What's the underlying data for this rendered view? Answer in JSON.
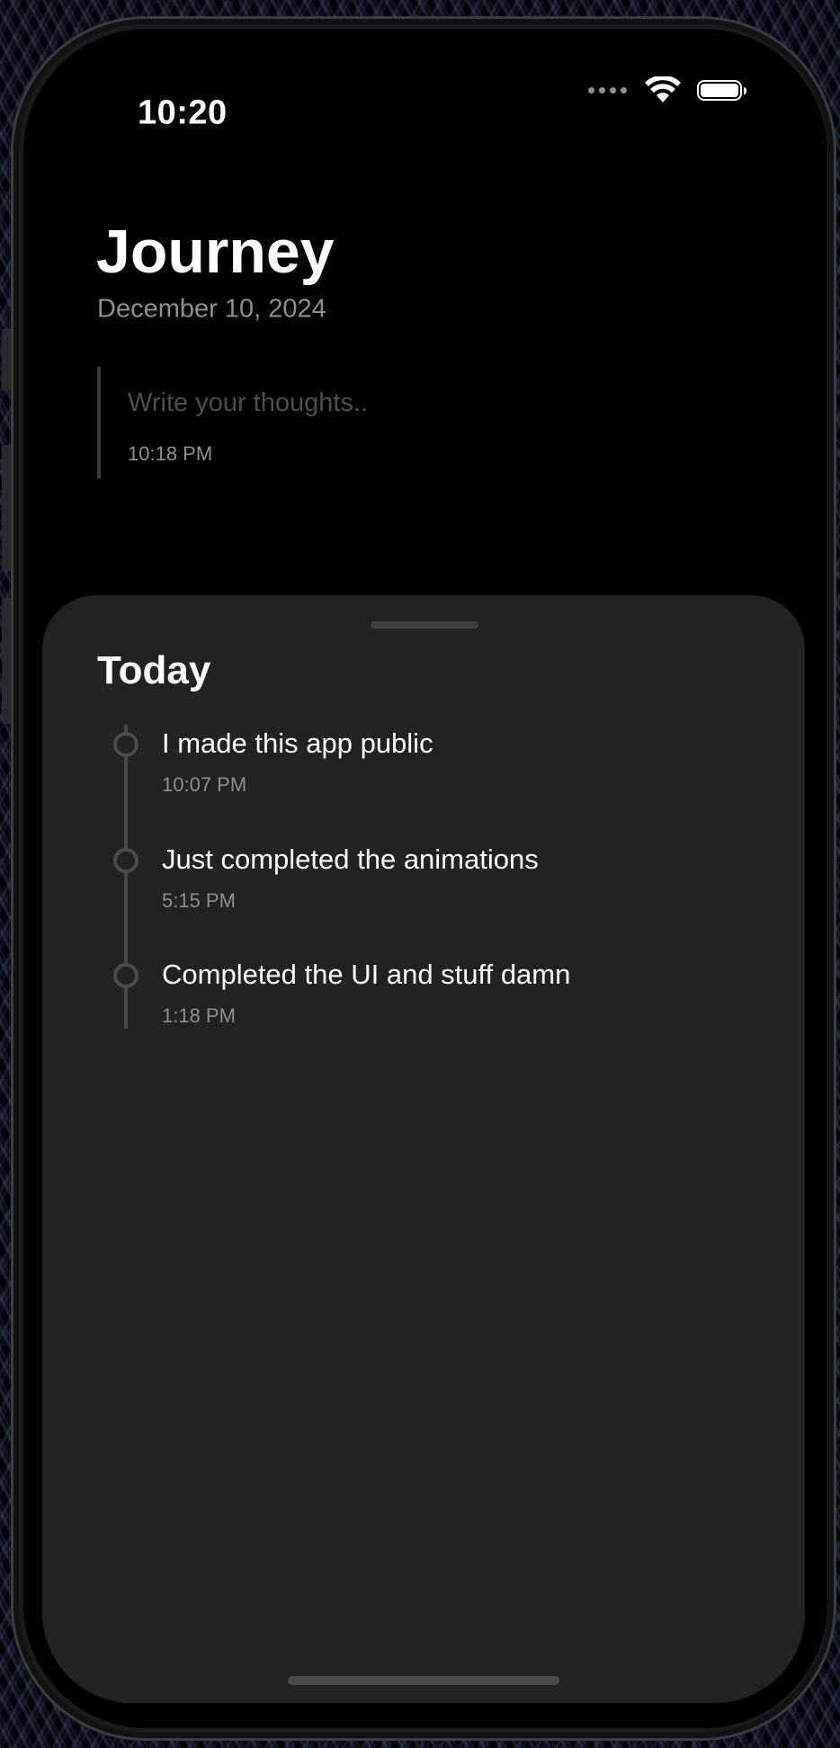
{
  "status_bar": {
    "time": "10:20",
    "icons": [
      "cellular-dots-icon",
      "wifi-icon",
      "battery-icon"
    ]
  },
  "header": {
    "title": "Journey",
    "date": "December 10, 2024"
  },
  "compose": {
    "placeholder": "Write your thoughts..",
    "time": "10:18 PM"
  },
  "today": {
    "title": "Today",
    "entries": [
      {
        "text": "I made this app public",
        "time": "10:07 PM"
      },
      {
        "text": "Just completed the animations",
        "time": "5:15 PM"
      },
      {
        "text": "Completed the UI and stuff damn",
        "time": "1:18 PM"
      }
    ]
  },
  "colors": {
    "background": "#000000",
    "sheet": "#222222",
    "text_primary": "#ffffff",
    "text_secondary": "#8e8e93",
    "timeline": "#4a4a4c"
  }
}
